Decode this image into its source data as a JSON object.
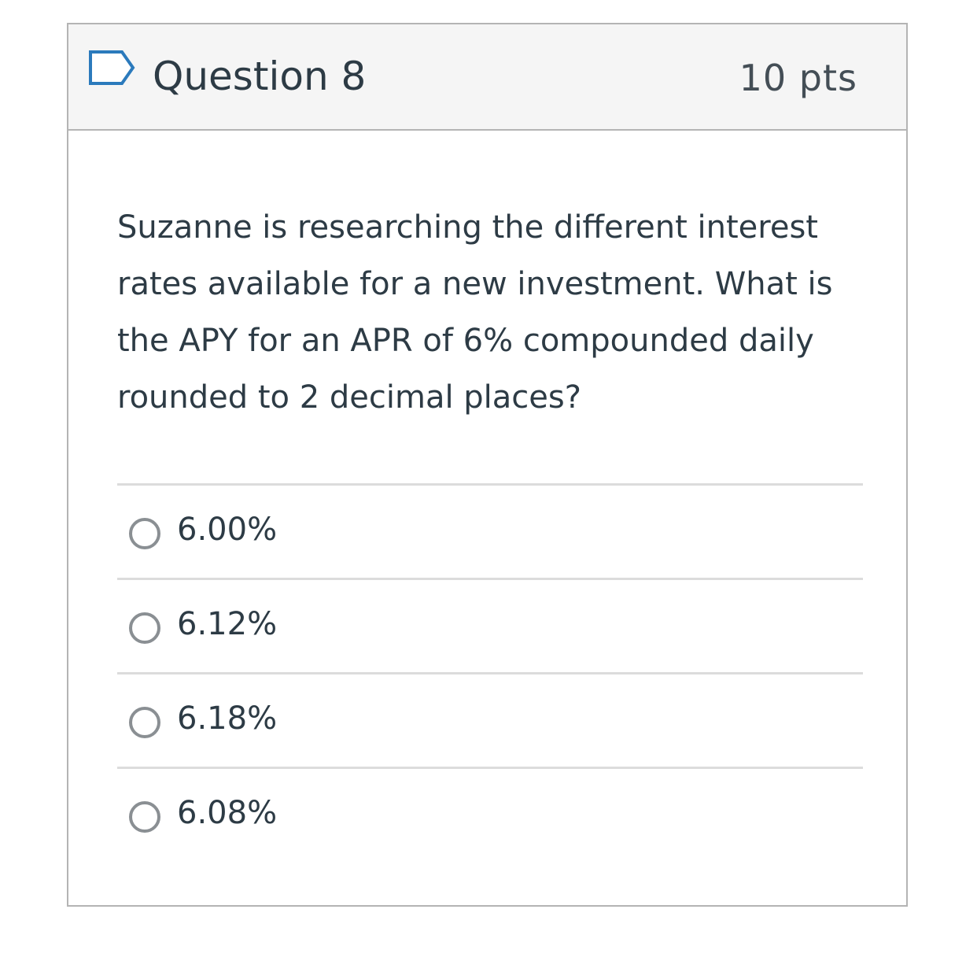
{
  "question": {
    "title": "Question 8",
    "points": "10 pts",
    "flag_icon": "flag-outline-icon",
    "text": "Suzanne is researching the different interest rates available for a new investment.  What is the APY for an APR of 6% compounded daily rounded to 2 decimal places?"
  },
  "answers": [
    {
      "label": "6.00%",
      "selected": false
    },
    {
      "label": "6.12%",
      "selected": false
    },
    {
      "label": "6.18%",
      "selected": false
    },
    {
      "label": "6.08%",
      "selected": false
    }
  ],
  "colors": {
    "header_background": "#f5f5f5",
    "border": "#b4b4b4",
    "text": "#2d3b45",
    "flag_stroke": "#2b7abc"
  }
}
